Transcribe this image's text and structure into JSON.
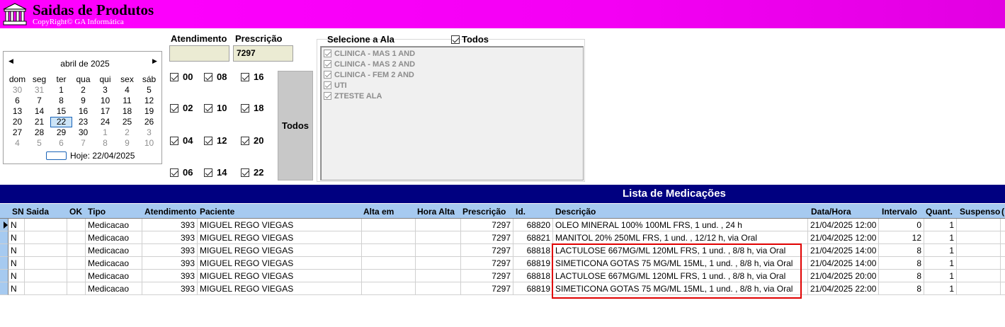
{
  "header": {
    "title": "Saidas de Produtos",
    "copyright": "CopyRight© GA Informática"
  },
  "calendar": {
    "month_label": "abril de 2025",
    "weekdays": [
      "dom",
      "seg",
      "ter",
      "qua",
      "qui",
      "sex",
      "sáb"
    ],
    "days": [
      {
        "d": "30",
        "dim": true
      },
      {
        "d": "31",
        "dim": true
      },
      {
        "d": "1"
      },
      {
        "d": "2"
      },
      {
        "d": "3"
      },
      {
        "d": "4"
      },
      {
        "d": "5"
      },
      {
        "d": "6"
      },
      {
        "d": "7"
      },
      {
        "d": "8"
      },
      {
        "d": "9"
      },
      {
        "d": "10"
      },
      {
        "d": "11"
      },
      {
        "d": "12"
      },
      {
        "d": "13"
      },
      {
        "d": "14"
      },
      {
        "d": "15"
      },
      {
        "d": "16"
      },
      {
        "d": "17"
      },
      {
        "d": "18"
      },
      {
        "d": "19"
      },
      {
        "d": "20"
      },
      {
        "d": "21"
      },
      {
        "d": "22",
        "today": true
      },
      {
        "d": "23"
      },
      {
        "d": "24"
      },
      {
        "d": "25"
      },
      {
        "d": "26"
      },
      {
        "d": "27"
      },
      {
        "d": "28"
      },
      {
        "d": "29"
      },
      {
        "d": "30"
      },
      {
        "d": "1",
        "dim": true
      },
      {
        "d": "2",
        "dim": true
      },
      {
        "d": "3",
        "dim": true
      },
      {
        "d": "4",
        "dim": true
      },
      {
        "d": "5",
        "dim": true
      },
      {
        "d": "6",
        "dim": true
      },
      {
        "d": "7",
        "dim": true
      },
      {
        "d": "8",
        "dim": true
      },
      {
        "d": "9",
        "dim": true
      },
      {
        "d": "10",
        "dim": true
      }
    ],
    "today_label": "Hoje: 22/04/2025"
  },
  "form": {
    "atendimento_label": "Atendimento",
    "atendimento_value": "",
    "prescricao_label": "Prescrição",
    "prescricao_value": "7297"
  },
  "hours": [
    "00",
    "08",
    "16",
    "02",
    "10",
    "18",
    "04",
    "12",
    "20",
    "06",
    "14",
    "22"
  ],
  "todos_button": "Todos",
  "ala": {
    "label": "Selecione a Ala",
    "todos_label": "Todos",
    "items": [
      "CLINICA - MAS 1 AND",
      "CLINICA - MAS 2 AND",
      "CLINICA - FEM 2 AND",
      "UTI",
      "ZTESTE ALA"
    ]
  },
  "list": {
    "title": "Lista de Medicações",
    "columns": [
      "SN",
      "Saida",
      "OK",
      "Tipo",
      "Atendimento",
      "Paciente",
      "Alta em",
      "Hora Alta",
      "Prescrição",
      "Id.",
      "Descrição",
      "Data/Hora",
      "Intervalo",
      "Quant.",
      "Suspenso",
      "("
    ],
    "rows": [
      {
        "sn": "N",
        "tipo": "Medicacao",
        "atendimento": "393",
        "paciente": "MIGUEL REGO VIEGAS",
        "prescricao": "7297",
        "id": "68820",
        "descricao": "OLEO MINERAL 100% 100ML FRS, 1 und. , 24 h",
        "datahora": "21/04/2025 12:00",
        "intervalo": "0",
        "quant": "1"
      },
      {
        "sn": "N",
        "tipo": "Medicacao",
        "atendimento": "393",
        "paciente": "MIGUEL REGO VIEGAS",
        "prescricao": "7297",
        "id": "68821",
        "descricao": "MANITOL 20% 250ML FRS, 1 und. , 12/12 h, via Oral",
        "datahora": "21/04/2025 12:00",
        "intervalo": "12",
        "quant": "1"
      },
      {
        "sn": "N",
        "tipo": "Medicacao",
        "atendimento": "393",
        "paciente": "MIGUEL REGO VIEGAS",
        "prescricao": "7297",
        "id": "68818",
        "descricao": "LACTULOSE 667MG/ML 120ML FRS, 1 und. , 8/8 h, via Oral",
        "datahora": "21/04/2025 14:00",
        "intervalo": "8",
        "quant": "1"
      },
      {
        "sn": "N",
        "tipo": "Medicacao",
        "atendimento": "393",
        "paciente": "MIGUEL REGO VIEGAS",
        "prescricao": "7297",
        "id": "68819",
        "descricao": "SIMETICONA GOTAS 75 MG/ML 15ML, 1 und. , 8/8 h, via Oral",
        "datahora": "21/04/2025 14:00",
        "intervalo": "8",
        "quant": "1"
      },
      {
        "sn": "N",
        "tipo": "Medicacao",
        "atendimento": "393",
        "paciente": "MIGUEL REGO VIEGAS",
        "prescricao": "7297",
        "id": "68818",
        "descricao": "LACTULOSE 667MG/ML 120ML FRS, 1 und. , 8/8 h, via Oral",
        "datahora": "21/04/2025 20:00",
        "intervalo": "8",
        "quant": "1"
      },
      {
        "sn": "N",
        "tipo": "Medicacao",
        "atendimento": "393",
        "paciente": "MIGUEL REGO VIEGAS",
        "prescricao": "7297",
        "id": "68819",
        "descricao": "SIMETICONA GOTAS 75 MG/ML 15ML, 1 und. , 8/8 h, via Oral",
        "datahora": "21/04/2025 22:00",
        "intervalo": "8",
        "quant": "1"
      }
    ]
  },
  "colors": {
    "header_start": "#ff00ff",
    "list_bar": "#000080",
    "column_header": "#a6caf0",
    "highlight": "#e00000"
  }
}
